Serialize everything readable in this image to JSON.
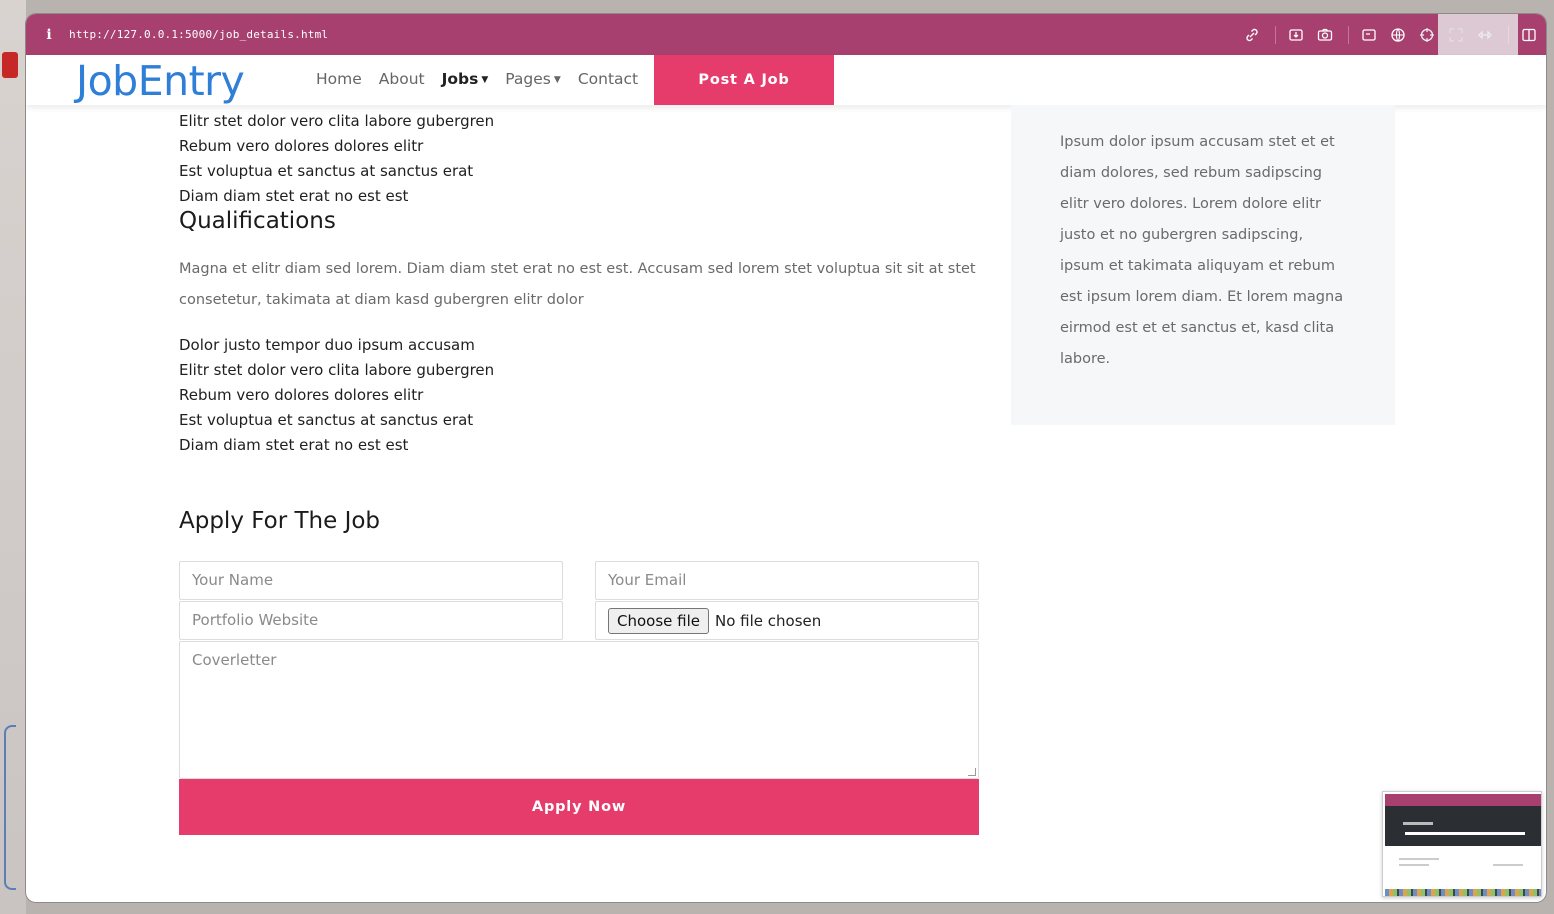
{
  "browser": {
    "info_icon": "i",
    "url": "http://127.0.0.1:5000/job_details.html",
    "toolbar_icons": [
      "link-icon",
      "save-icon",
      "camera-icon",
      "window-icon",
      "globe-icon",
      "target-icon",
      "fullscreen-icon",
      "swap-icon",
      "sidebar-icon"
    ]
  },
  "nav": {
    "brand": "JobEntry",
    "links": [
      "Home",
      "About",
      "Jobs",
      "Pages",
      "Contact"
    ],
    "active": "Jobs",
    "post_job": "Post A Job"
  },
  "responsibilities_tail": [
    "Elitr stet dolor vero clita labore gubergren",
    "Rebum vero dolores dolores elitr",
    "Est voluptua et sanctus at sanctus erat",
    "Diam diam stet erat no est est"
  ],
  "qualifications": {
    "heading": "Qualifications",
    "paragraph": "Magna et elitr diam sed lorem. Diam diam stet erat no est est. Accusam sed lorem stet voluptua sit sit at stet consetetur, takimata at diam kasd gubergren elitr dolor",
    "items": [
      "Dolor justo tempor duo ipsum accusam",
      "Elitr stet dolor vero clita labore gubergren",
      "Rebum vero dolores dolores elitr",
      "Est voluptua et sanctus at sanctus erat",
      "Diam diam stet erat no est est"
    ]
  },
  "apply": {
    "heading": "Apply For The Job",
    "name_placeholder": "Your Name",
    "email_placeholder": "Your Email",
    "portfolio_placeholder": "Portfolio Website",
    "file_button": "Choose file",
    "file_status": "No file chosen",
    "cover_placeholder": "Coverletter",
    "submit": "Apply Now"
  },
  "sidebar": {
    "text": "Ipsum dolor ipsum accusam stet et et diam dolores, sed rebum sadipscing elitr vero dolores. Lorem dolore elitr justo et no gubergren sadipscing, ipsum et takimata aliquyam et rebum est ipsum lorem diam. Et lorem magna eirmod est et et sanctus et, kasd clita labore."
  },
  "colors": {
    "accent": "#e63c6b",
    "brand": "#2f7ed8",
    "address_bar": "#a7406f"
  }
}
